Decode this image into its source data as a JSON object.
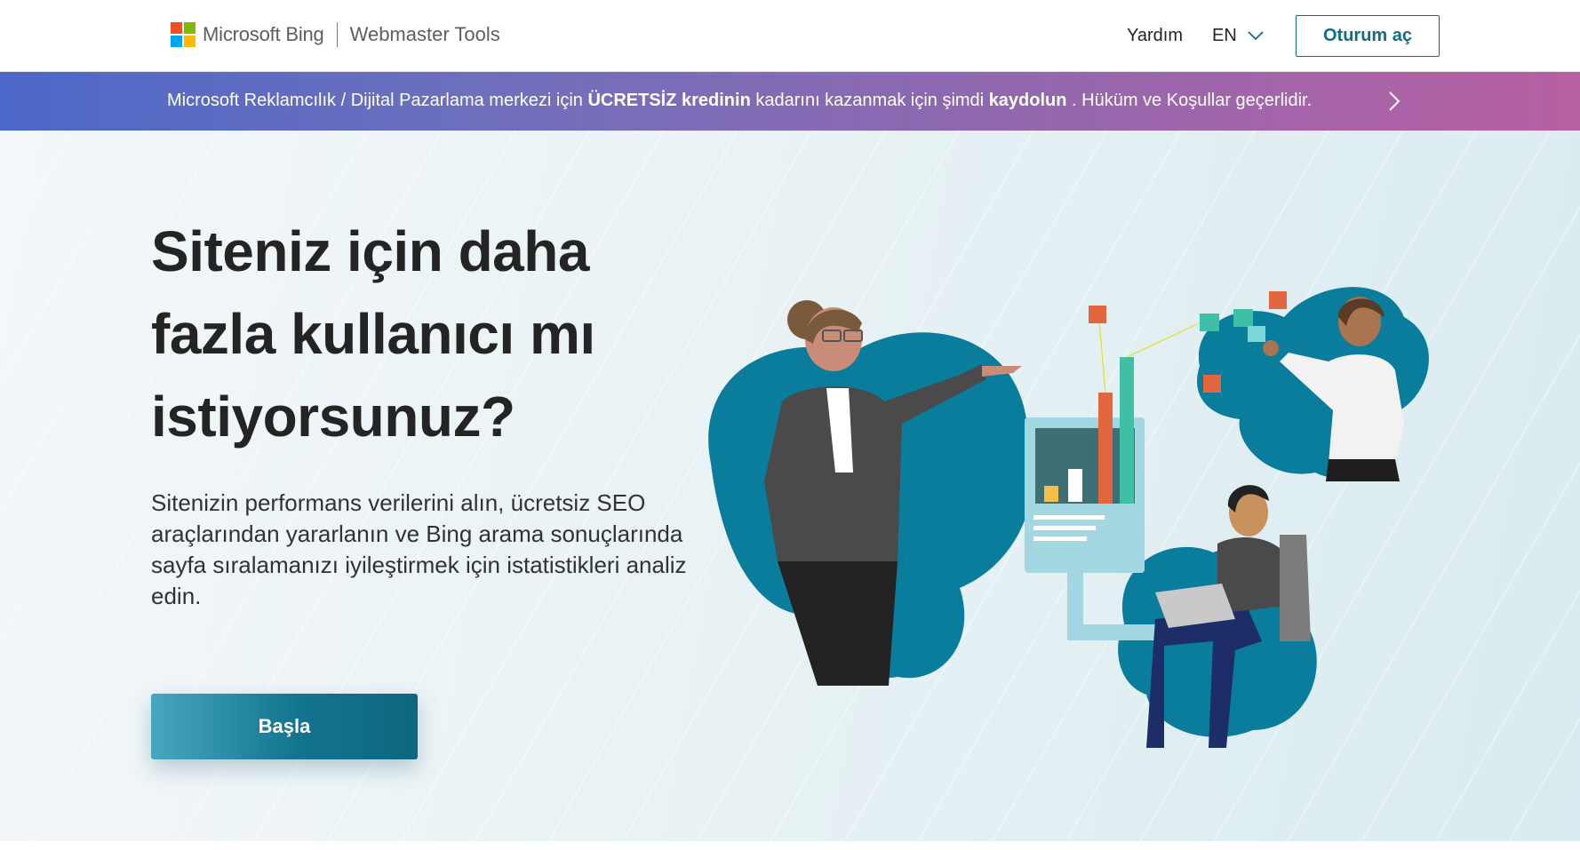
{
  "header": {
    "brand_ms": "Microsoft Bing",
    "brand_product": "Webmaster Tools",
    "help_link": "Yardım",
    "language": "EN",
    "signin_button": "Oturum aç"
  },
  "promo": {
    "part1": "Microsoft Reklamcılık / Dijital Pazarlama merkezi için ",
    "bold1": "ÜCRETSİZ kredinin",
    "part2": " kadarını kazanmak için şimdi ",
    "bold2": "kaydolun",
    "part3": " .  Hüküm ve Koşullar geçerlidir."
  },
  "hero": {
    "headline": "Siteniz için daha fazla kullanıcı mı istiyorsunuz?",
    "description": "Sitenizin performans verilerini alın, ücretsiz SEO araçlarından yararlanın ve Bing arama sonuçlarında sayfa sıralamanızı iyileştirmek için istatistikleri analiz edin.",
    "cta_button": "Başla"
  },
  "colors": {
    "accent": "#0f6c86",
    "ms_red": "#f25022",
    "ms_green": "#7fba00",
    "ms_blue": "#00a4ef",
    "ms_yellow": "#ffb900",
    "blob_teal": "#0a7c9c"
  },
  "icons": {
    "logo": "microsoft-logo",
    "language_caret": "chevron-down-icon",
    "promo_arrow": "chevron-right-icon"
  }
}
